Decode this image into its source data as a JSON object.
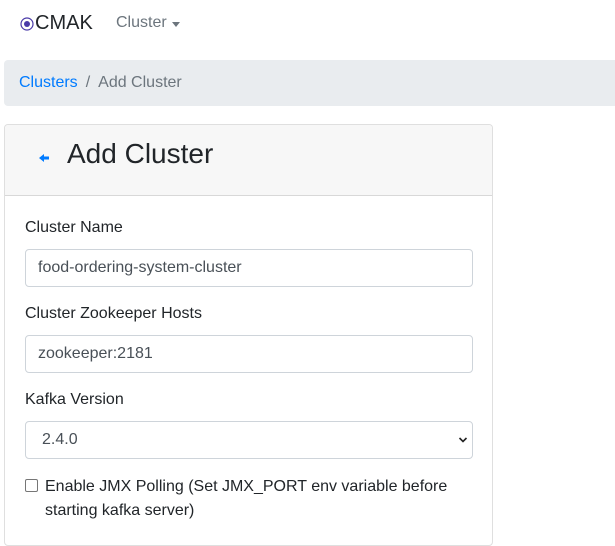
{
  "navbar": {
    "brand": "CMAK",
    "brand_icon": "radio-target-icon",
    "cluster_menu": "Cluster"
  },
  "breadcrumb": {
    "items": [
      {
        "label": "Clusters"
      },
      {
        "label": "Add Cluster"
      }
    ],
    "separator": "/"
  },
  "card": {
    "title": "Add Cluster",
    "back_icon": "arrow-left-icon"
  },
  "form": {
    "cluster_name": {
      "label": "Cluster Name",
      "value": "food-ordering-system-cluster"
    },
    "zookeeper_hosts": {
      "label": "Cluster Zookeeper Hosts",
      "value": "zookeeper:2181"
    },
    "kafka_version": {
      "label": "Kafka Version",
      "selected": "2.4.0"
    },
    "jmx_polling": {
      "label": "Enable JMX Polling (Set JMX_PORT env variable before starting kafka server)",
      "checked": false
    }
  },
  "colors": {
    "link": "#007bff",
    "muted": "#6c757d",
    "breadcrumb_bg": "#e9ecef",
    "card_header_bg": "#f7f7f7",
    "brand_icon": "#4a3aa8"
  }
}
